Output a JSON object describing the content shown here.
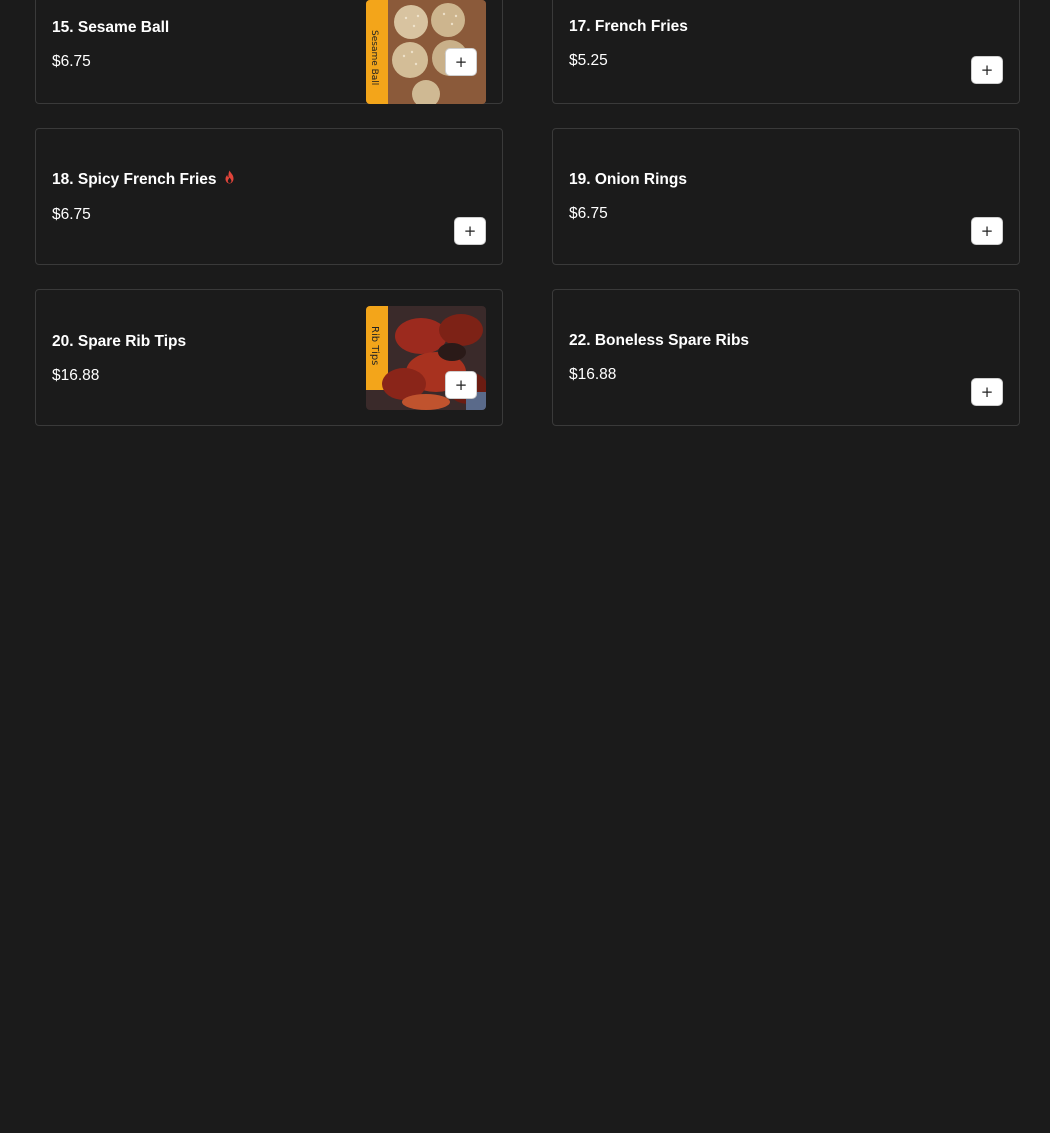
{
  "items": [
    {
      "number_name": "15. Sesame Ball",
      "price": "$6.75",
      "has_image": true,
      "image": "sesame-balls-photo",
      "image_label": "Sesame Ball",
      "add_icon": "plus-icon"
    },
    {
      "number_name": "17. French Fries",
      "price": "$5.25",
      "has_image": false,
      "add_icon": "plus-icon"
    },
    {
      "number_name": "18. Spicy French Fries",
      "price": "$6.75",
      "has_image": false,
      "spicy_icon": "fire-icon",
      "spicy_color": "#e0443a",
      "add_icon": "plus-icon"
    },
    {
      "number_name": "19. Onion Rings",
      "price": "$6.75",
      "has_image": false,
      "add_icon": "plus-icon"
    },
    {
      "number_name": "20. Spare Rib Tips",
      "price": "$16.88",
      "has_image": true,
      "image": "rib-tips-photo",
      "image_label": "Rib Tips",
      "add_icon": "plus-icon"
    },
    {
      "number_name": "22. Boneless Spare Ribs",
      "price": "$16.88",
      "has_image": false,
      "add_icon": "plus-icon"
    }
  ],
  "add_button_symbol": "+",
  "colors": {
    "background": "#1b1b1b",
    "card_border": "#3a3a3a",
    "text": "#ffffff",
    "button_bg": "#ffffff"
  }
}
